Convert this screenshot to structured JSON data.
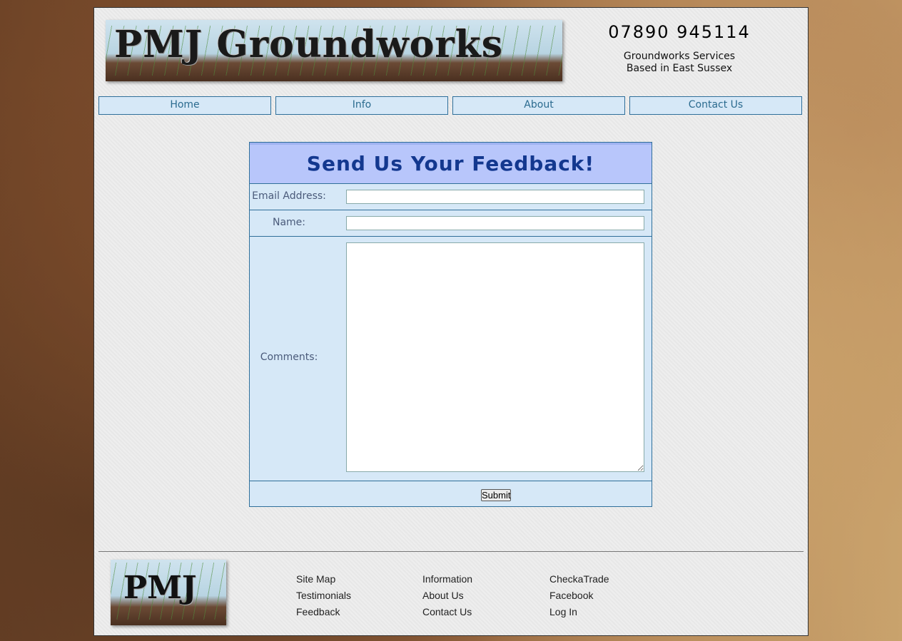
{
  "header": {
    "logo_text": "PMJ Groundworks",
    "phone": "07890 945114",
    "tagline_line1": "Groundworks Services",
    "tagline_line2": "Based in East Sussex"
  },
  "nav": {
    "items": [
      {
        "label": "Home"
      },
      {
        "label": "Info"
      },
      {
        "label": "About"
      },
      {
        "label": "Contact Us"
      }
    ]
  },
  "form": {
    "title": "Send Us Your Feedback!",
    "email_label": "Email Address:",
    "email_value": "",
    "name_label": "Name:",
    "name_value": "",
    "comments_label": "Comments:",
    "comments_value": "",
    "submit_label": "Submit"
  },
  "footer": {
    "logo_text": "PMJ",
    "col1": [
      "Site Map",
      "Testimonials",
      "Feedback"
    ],
    "col2": [
      "Information",
      "About Us",
      "Contact Us"
    ],
    "col3": [
      "CheckaTrade",
      "Facebook",
      "Log In"
    ]
  },
  "colors": {
    "nav_bg": "#d6e8f7",
    "nav_border": "#2f6f9a",
    "form_title_bg": "#b8c6fb",
    "form_title_text": "#13388f"
  }
}
